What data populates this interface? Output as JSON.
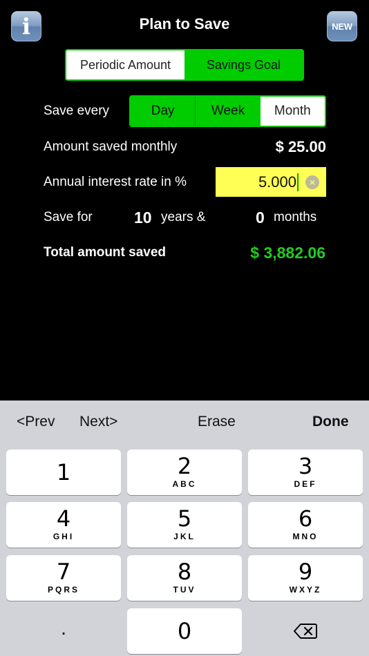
{
  "header": {
    "info_label": "i",
    "title": "Plan to Save",
    "new_label": "NEW"
  },
  "mode_tabs": [
    {
      "label": "Periodic Amount",
      "selected": false
    },
    {
      "label": "Savings Goal",
      "selected": true
    }
  ],
  "save_every": {
    "label": "Save every",
    "options": [
      {
        "label": "Day",
        "selected": true
      },
      {
        "label": "Week",
        "selected": true
      },
      {
        "label": "Month",
        "selected": false
      }
    ]
  },
  "amount": {
    "label": "Amount saved monthly",
    "value": "$ 25.00"
  },
  "interest": {
    "label": "Annual interest rate in %",
    "value": "5.000"
  },
  "duration": {
    "label": "Save for",
    "years": "10",
    "years_label": "years &",
    "months": "0",
    "months_label": "months"
  },
  "total": {
    "label": "Total amount saved",
    "value": "$ 3,882.06"
  },
  "colors": {
    "accent_green": "#00cc00",
    "total_green": "#22cc22",
    "input_yellow": "#ffff55",
    "button_blue": "#6f90ba"
  },
  "keyboard": {
    "toolbar": {
      "prev": "<Prev",
      "next": "Next>",
      "erase": "Erase",
      "done": "Done"
    },
    "keys": [
      {
        "num": "1",
        "letters": ""
      },
      {
        "num": "2",
        "letters": "ABC"
      },
      {
        "num": "3",
        "letters": "DEF"
      },
      {
        "num": "4",
        "letters": "GHI"
      },
      {
        "num": "5",
        "letters": "JKL"
      },
      {
        "num": "6",
        "letters": "MNO"
      },
      {
        "num": "7",
        "letters": "PQRS"
      },
      {
        "num": "8",
        "letters": "TUV"
      },
      {
        "num": "9",
        "letters": "WXYZ"
      },
      {
        "num": "0",
        "letters": ""
      }
    ],
    "dot": ".",
    "backspace_icon": "backspace-icon"
  }
}
